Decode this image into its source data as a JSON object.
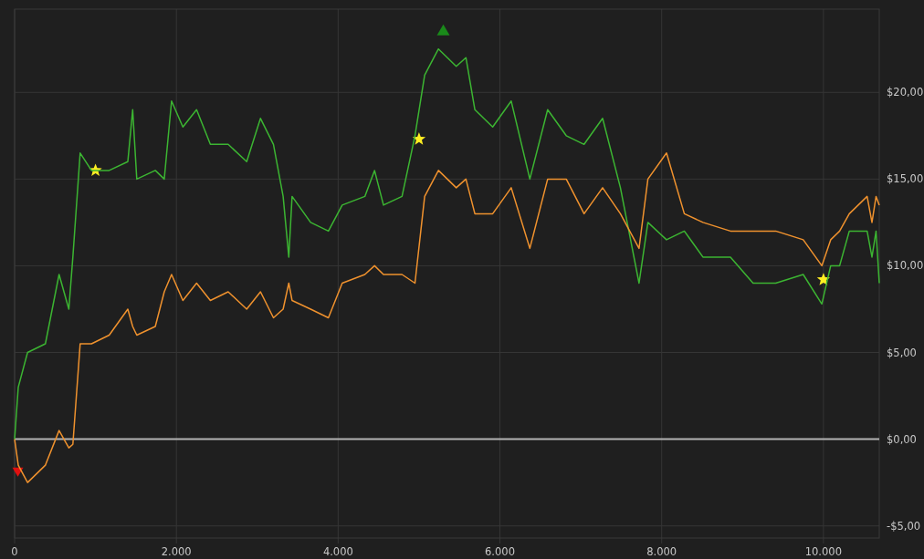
{
  "chart": {
    "chart_data": {
      "type": "line",
      "x": [
        0,
        45,
        160,
        380,
        550,
        670,
        720,
        810,
        950,
        1170,
        1400,
        1460,
        1510,
        1740,
        1850,
        1940,
        2080,
        2250,
        2420,
        2640,
        2870,
        3040,
        3200,
        3320,
        3390,
        3430,
        3660,
        3880,
        4050,
        4330,
        4450,
        4560,
        4790,
        4950,
        5070,
        5240,
        5460,
        5580,
        5690,
        5910,
        6140,
        6370,
        6590,
        6820,
        7040,
        7270,
        7490,
        7720,
        7830,
        8060,
        8280,
        8510,
        8850,
        9130,
        9410,
        9750,
        9980,
        10090,
        10200,
        10320,
        10540,
        10600,
        10650,
        10690
      ],
      "series": [
        {
          "color": "#3cb532",
          "values": [
            0,
            3,
            5,
            5.5,
            9.5,
            7.5,
            10.5,
            16.5,
            15.5,
            15.5,
            16,
            19,
            15,
            15.5,
            15,
            19.5,
            18,
            19,
            17,
            17,
            16,
            18.5,
            17,
            14,
            10.5,
            14,
            12.5,
            12,
            13.5,
            14,
            15.5,
            13.5,
            14,
            17.5,
            21,
            22.5,
            21.5,
            22,
            19,
            18,
            19.5,
            15,
            19,
            17.5,
            17,
            18.5,
            14.5,
            9,
            12.5,
            11.5,
            12,
            10.5,
            10.5,
            9,
            9,
            9.5,
            7.8,
            10,
            10,
            12,
            12,
            10.5,
            12,
            9
          ]
        },
        {
          "color": "#f0922e",
          "values": [
            0,
            -1.5,
            -2.5,
            -1.5,
            0.5,
            -0.5,
            -0.3,
            5.5,
            5.5,
            6,
            7.5,
            6.5,
            6,
            6.5,
            8.5,
            9.5,
            8,
            9,
            8,
            8.5,
            7.5,
            8.5,
            7,
            7.5,
            9,
            8,
            7.5,
            7,
            9,
            9.5,
            10,
            9.5,
            9.5,
            9,
            14,
            15.5,
            14.5,
            15,
            13,
            13,
            14.5,
            11,
            15,
            15,
            13,
            14.5,
            13,
            11,
            15,
            16.5,
            13,
            12.5,
            12,
            12,
            12,
            11.5,
            10,
            11.5,
            12,
            13,
            14,
            12.5,
            14,
            13.5
          ]
        }
      ],
      "grid": true,
      "xlim": [
        0,
        10690
      ],
      "ylim": [
        -5.7,
        24.8
      ],
      "xticks": [
        {
          "value": 0,
          "label": "0"
        },
        {
          "value": 2000,
          "label": "2.000"
        },
        {
          "value": 4000,
          "label": "4.000"
        },
        {
          "value": 6000,
          "label": "6.000"
        },
        {
          "value": 8000,
          "label": "8.000"
        },
        {
          "value": 10000,
          "label": "10.000"
        }
      ],
      "yticks": [
        {
          "value": -5,
          "label": "-$5,00"
        },
        {
          "value": 0,
          "label": "$0,00"
        },
        {
          "value": 5,
          "label": "$5,00"
        },
        {
          "value": 10,
          "label": "$10,00"
        },
        {
          "value": 15,
          "label": "$15,00"
        },
        {
          "value": 20,
          "label": "$20,00"
        }
      ]
    },
    "markers": [
      {
        "kind": "star",
        "color": "#ffee22"
      },
      {
        "kind": "star",
        "color": "#ffee22"
      },
      {
        "kind": "star",
        "color": "#ffee22"
      },
      {
        "kind": "triangle-up",
        "color": "#1a8a1a"
      },
      {
        "kind": "triangle-down",
        "color": "#e01010"
      }
    ]
  }
}
